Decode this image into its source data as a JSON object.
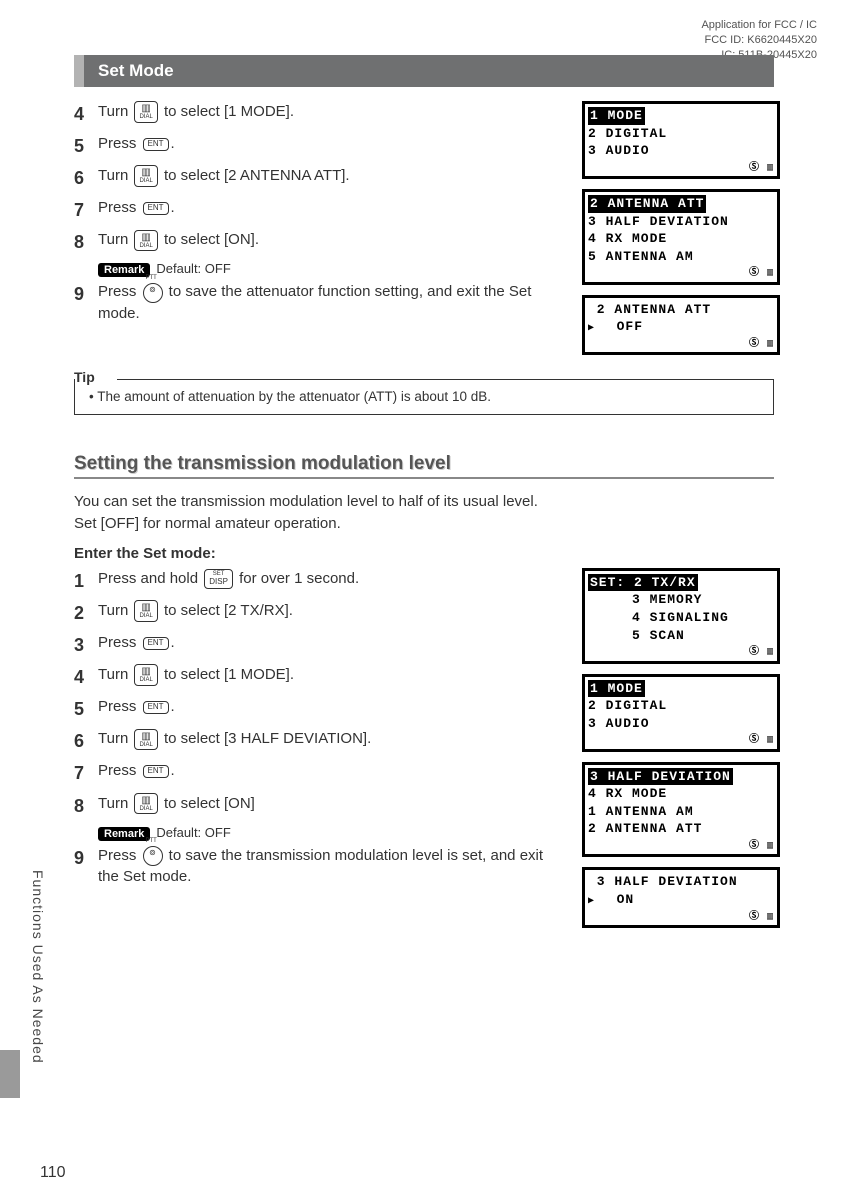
{
  "header": {
    "line1": "Application for FCC / IC",
    "line2": "FCC ID: K6620445X20",
    "line3": "IC: 511B-20445X20"
  },
  "setModeBar": "Set Mode",
  "iconLabels": {
    "dial": "DIAL",
    "ent": "ENT",
    "disp": "DISP",
    "dispTop": "SET",
    "ptt": "⊚"
  },
  "stepsA": [
    {
      "n": "4",
      "pre": "Turn ",
      "icon": "dial",
      "post": " to select [1 MODE]."
    },
    {
      "n": "5",
      "pre": "Press ",
      "icon": "ent",
      "post": "."
    },
    {
      "n": "6",
      "pre": "Turn ",
      "icon": "dial",
      "post": " to select [2 ANTENNA ATT]."
    },
    {
      "n": "7",
      "pre": "Press ",
      "icon": "ent",
      "post": "."
    },
    {
      "n": "8",
      "pre": "Turn ",
      "icon": "dial",
      "post": " to select [ON]."
    }
  ],
  "remarkA": {
    "label": "Remark",
    "text": "Default: OFF"
  },
  "stepA9": {
    "n": "9",
    "pre": "Press ",
    "icon": "ptt",
    "post": " to save the attenuator function setting, and exit the Set mode."
  },
  "tip": {
    "label": "Tip",
    "text": "• The amount of attenuation by the attenuator (ATT) is about 10 dB."
  },
  "sectionHeading": "Setting the transmission modulation level",
  "sectionBody": "You can set the transmission modulation level to half of its usual level.\nSet [OFF] for normal amateur operation.",
  "subhead": "Enter the Set mode:",
  "stepsB": [
    {
      "n": "1",
      "pre": "Press and hold ",
      "icon": "disp",
      "post": " for over 1 second."
    },
    {
      "n": "2",
      "pre": "Turn ",
      "icon": "dial",
      "post": " to select [2 TX/RX]."
    },
    {
      "n": "3",
      "pre": "Press ",
      "icon": "ent",
      "post": "."
    },
    {
      "n": "4",
      "pre": "Turn ",
      "icon": "dial",
      "post": " to select [1 MODE]."
    },
    {
      "n": "5",
      "pre": "Press ",
      "icon": "ent",
      "post": "."
    },
    {
      "n": "6",
      "pre": "Turn ",
      "icon": "dial",
      "post": " to select [3 HALF DEVIATION]."
    },
    {
      "n": "7",
      "pre": "Press ",
      "icon": "ent",
      "post": "."
    },
    {
      "n": "8",
      "pre": "Turn ",
      "icon": "dial",
      "post": " to select [ON]"
    }
  ],
  "remarkB": {
    "label": "Remark",
    "text": "Default: OFF"
  },
  "stepB9": {
    "n": "9",
    "pre": "Press ",
    "icon": "ptt",
    "post": " to save the transmission modulation level is set, and exit the Set mode."
  },
  "screensA": [
    {
      "lines": [
        {
          "t": "1 MODE",
          "hl": true
        },
        {
          "t": "2 DIGITAL"
        },
        {
          "t": "3 AUDIO"
        }
      ],
      "status": "Ⓢ ▥"
    },
    {
      "lines": [
        {
          "t": "2 ANTENNA ATT",
          "hl": true
        },
        {
          "t": "3 HALF DEVIATION"
        },
        {
          "t": "4 RX MODE"
        },
        {
          "t": "5 ANTENNA AM"
        }
      ],
      "status": "Ⓢ ▥"
    },
    {
      "lines": [
        {
          "t": " 2 ANTENNA ATT"
        },
        {
          "t": ""
        },
        {
          "t": "  OFF",
          "arrow": true
        }
      ],
      "status": "Ⓢ ▥"
    }
  ],
  "screensB": [
    {
      "lines": [
        {
          "t": "SET: 2 TX/RX",
          "hl": true
        },
        {
          "t": "     3 MEMORY"
        },
        {
          "t": "     4 SIGNALING"
        },
        {
          "t": "     5 SCAN"
        }
      ],
      "status": "Ⓢ ▥"
    },
    {
      "lines": [
        {
          "t": "1 MODE",
          "hl": true
        },
        {
          "t": "2 DIGITAL"
        },
        {
          "t": "3 AUDIO"
        }
      ],
      "status": "Ⓢ ▥"
    },
    {
      "lines": [
        {
          "t": "3 HALF DEVIATION",
          "hl": true
        },
        {
          "t": "4 RX MODE"
        },
        {
          "t": "1 ANTENNA AM"
        },
        {
          "t": "2 ANTENNA ATT"
        }
      ],
      "status": "Ⓢ ▥"
    },
    {
      "lines": [
        {
          "t": " 3 HALF DEVIATION"
        },
        {
          "t": ""
        },
        {
          "t": "  ON",
          "arrow": true
        }
      ],
      "status": "Ⓢ ▥"
    }
  ],
  "sideLabel": "Functions Used As Needed",
  "pageNum": "110"
}
